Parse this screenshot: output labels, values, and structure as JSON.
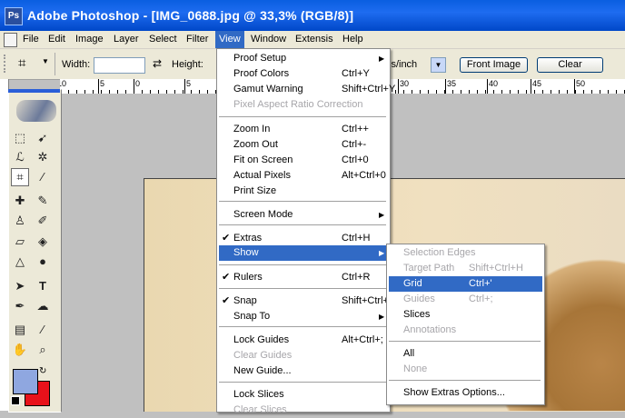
{
  "title": "Adobe Photoshop - [IMG_0688.jpg @ 33,3% (RGB/8)]",
  "menubar": [
    "File",
    "Edit",
    "Image",
    "Layer",
    "Select",
    "Filter",
    "View",
    "Window",
    "Extensis",
    "Help"
  ],
  "options": {
    "width_label": "Width:",
    "height_label": "Height:",
    "resolution_unit": "ls/inch",
    "front_image": "Front Image",
    "clear": "Clear"
  },
  "ruler_labels": [
    "15",
    "10",
    "5",
    "0",
    "5",
    "30",
    "35",
    "40",
    "45",
    "50"
  ],
  "view_menu": [
    {
      "label": "Proof Setup",
      "shortcut": "",
      "sub": true
    },
    {
      "label": "Proof Colors",
      "shortcut": "Ctrl+Y"
    },
    {
      "label": "Gamut Warning",
      "shortcut": "Shift+Ctrl+Y"
    },
    {
      "label": "Pixel Aspect Ratio Correction",
      "shortcut": "",
      "disabled": true
    },
    {
      "label": "Zoom In",
      "shortcut": "Ctrl++"
    },
    {
      "label": "Zoom Out",
      "shortcut": "Ctrl+-"
    },
    {
      "label": "Fit on Screen",
      "shortcut": "Ctrl+0"
    },
    {
      "label": "Actual Pixels",
      "shortcut": "Alt+Ctrl+0"
    },
    {
      "label": "Print Size",
      "shortcut": ""
    },
    {
      "label": "Screen Mode",
      "shortcut": "",
      "sub": true
    },
    {
      "label": "Extras",
      "shortcut": "Ctrl+H",
      "checked": true
    },
    {
      "label": "Show",
      "shortcut": "",
      "sub": true,
      "highlight": true
    },
    {
      "label": "Rulers",
      "shortcut": "Ctrl+R",
      "checked": true
    },
    {
      "label": "Snap",
      "shortcut": "Shift+Ctrl+;",
      "checked": true
    },
    {
      "label": "Snap To",
      "shortcut": "",
      "sub": true
    },
    {
      "label": "Lock Guides",
      "shortcut": "Alt+Ctrl+;"
    },
    {
      "label": "Clear Guides",
      "shortcut": "",
      "disabled": true
    },
    {
      "label": "New Guide...",
      "shortcut": ""
    },
    {
      "label": "Lock Slices",
      "shortcut": ""
    },
    {
      "label": "Clear Slices",
      "shortcut": "",
      "disabled": true
    }
  ],
  "show_menu": [
    {
      "label": "Selection Edges",
      "shortcut": "",
      "disabled": true
    },
    {
      "label": "Target Path",
      "shortcut": "Shift+Ctrl+H",
      "disabled": true
    },
    {
      "label": "Grid",
      "shortcut": "Ctrl+'",
      "highlight": true
    },
    {
      "label": "Guides",
      "shortcut": "Ctrl+;",
      "disabled": true
    },
    {
      "label": "Slices",
      "shortcut": ""
    },
    {
      "label": "Annotations",
      "shortcut": "",
      "disabled": true
    },
    {
      "label": "All",
      "shortcut": ""
    },
    {
      "label": "None",
      "shortcut": "",
      "disabled": true
    },
    {
      "label": "Show Extras Options...",
      "shortcut": ""
    }
  ],
  "colors": {
    "foreground": "#8fa7e0",
    "background": "#e8111a",
    "highlight": "#316ac5"
  }
}
